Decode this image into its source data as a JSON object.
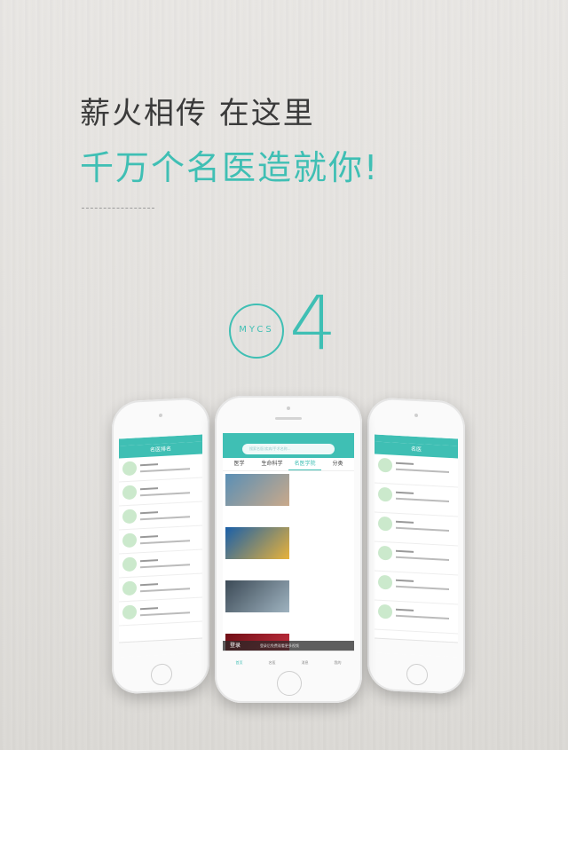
{
  "headline": {
    "line1": "薪火相传 在这里",
    "line2": "千万个名医造就你!"
  },
  "badge": {
    "text": "MYCS",
    "number": "4"
  },
  "phones": {
    "left": {
      "nav_title": "名医排名"
    },
    "center": {
      "search_placeholder": "搜索名医/疾病/手术名称...",
      "tabs": [
        "医学",
        "生命科学",
        "名医学院",
        "分类"
      ],
      "login_label": "登录",
      "login_hint": "登录后免费观看更多视频",
      "tabbar": [
        "首页",
        "名医",
        "消息",
        "我的"
      ]
    },
    "right": {
      "nav_title": "名医"
    }
  },
  "colors": {
    "accent": "#3fbfb4"
  }
}
